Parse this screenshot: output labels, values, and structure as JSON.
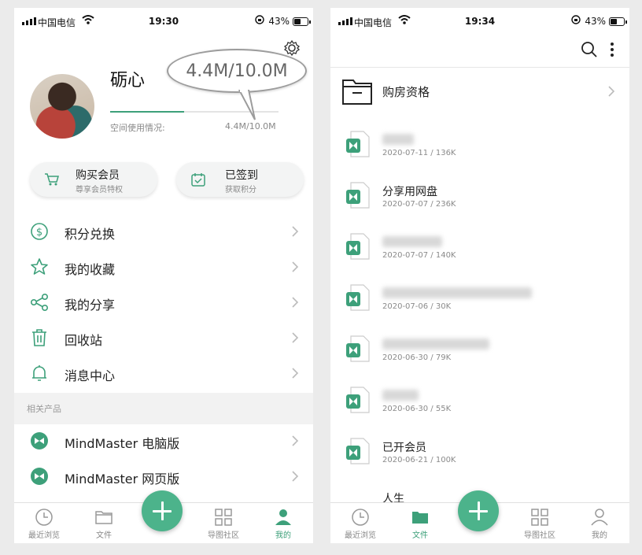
{
  "status_left": {
    "carrier": "中国电信",
    "time": "19:30",
    "battery": "43%"
  },
  "status_right": {
    "carrier": "中国电信",
    "time": "19:34",
    "battery": "43%"
  },
  "profile": {
    "name": "砺心",
    "usage_label": "空间使用情况:",
    "usage_value": "4.4M/10.0M",
    "usage_fraction": 0.44,
    "callout": "4.4M/10.0M"
  },
  "cards": {
    "vip": {
      "title": "购买会员",
      "subtitle": "尊享会员特权"
    },
    "sign": {
      "title": "已签到",
      "subtitle": "获取积分"
    }
  },
  "menu": [
    {
      "label": "积分兑换",
      "icon": "dollar-icon"
    },
    {
      "label": "我的收藏",
      "icon": "star-icon"
    },
    {
      "label": "我的分享",
      "icon": "share-icon"
    },
    {
      "label": "回收站",
      "icon": "trash-icon"
    },
    {
      "label": "消息中心",
      "icon": "bell-icon"
    }
  ],
  "related_section": "相关产品",
  "products": [
    {
      "label": "MindMaster 电脑版",
      "icon": "mindmaster-icon"
    },
    {
      "label": "MindMaster 网页版",
      "icon": "mindmaster-icon"
    }
  ],
  "tabs": [
    "最近浏览",
    "文件",
    "导图社区",
    "我的"
  ],
  "left_active_tab": "我的",
  "right_active_tab": "文件",
  "folder": {
    "label": "购房资格"
  },
  "files": [
    {
      "name": "",
      "blurred": true,
      "meta": "2020-07-11 / 136K"
    },
    {
      "name": "分享用网盘",
      "blurred": false,
      "meta": "2020-07-07 / 236K"
    },
    {
      "name": "",
      "blurred": true,
      "meta": "2020-07-07 / 140K"
    },
    {
      "name": "",
      "blurred": true,
      "meta": "2020-07-06 / 30K"
    },
    {
      "name": "",
      "blurred": true,
      "meta": "2020-06-30 / 79K"
    },
    {
      "name": "",
      "blurred": true,
      "meta": "2020-06-30 / 55K"
    },
    {
      "name": "已开会员",
      "blurred": false,
      "meta": "2020-06-21 / 100K"
    },
    {
      "name": "人生",
      "blurred": false,
      "meta": ""
    }
  ],
  "colors": {
    "accent": "#4cb38b",
    "accent_dark": "#3da07a"
  }
}
